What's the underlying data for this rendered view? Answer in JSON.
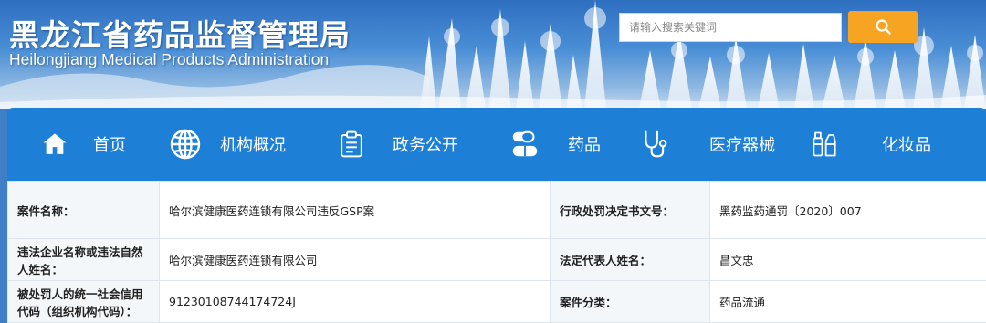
{
  "header": {
    "title": "黑龙江省药品监督管理局",
    "subtitle": "Heilongjiang Medical Products Administration"
  },
  "search": {
    "placeholder": "请输入搜索关键词",
    "button_icon": "search-icon"
  },
  "nav": {
    "items": [
      {
        "label": "首页",
        "icon": "home-icon"
      },
      {
        "label": "机构概况",
        "icon": "globe-icon"
      },
      {
        "label": "政务公开",
        "icon": "clipboard-icon"
      },
      {
        "label": "药品",
        "icon": "capsule-icon"
      },
      {
        "label": "医疗器械",
        "icon": "stethoscope-icon"
      },
      {
        "label": "化妆品",
        "icon": "cosmetics-icon"
      }
    ]
  },
  "table": {
    "rows": [
      {
        "k1": "案件名称：",
        "v1": "哈尔滨健康医药连锁有限公司违反GSP案",
        "k2": "行政处罚决定书文号：",
        "v2": "黑药监药通罚〔2020〕007"
      },
      {
        "k1": "违法企业名称或违法自然人姓名：",
        "v1": "哈尔滨健康医药连锁有限公司",
        "k2": "法定代表人姓名：",
        "v2": "昌文忠"
      },
      {
        "k1": "被处罚人的统一社会信用代码（组织机构代码）：",
        "v1": "91230108744174724J",
        "k2": "案件分类：",
        "v2": "药品流通"
      }
    ]
  },
  "colors": {
    "nav_background": "#1d7fd6",
    "search_button": "#f7a423",
    "table_key_background": "#f4f7fa"
  }
}
